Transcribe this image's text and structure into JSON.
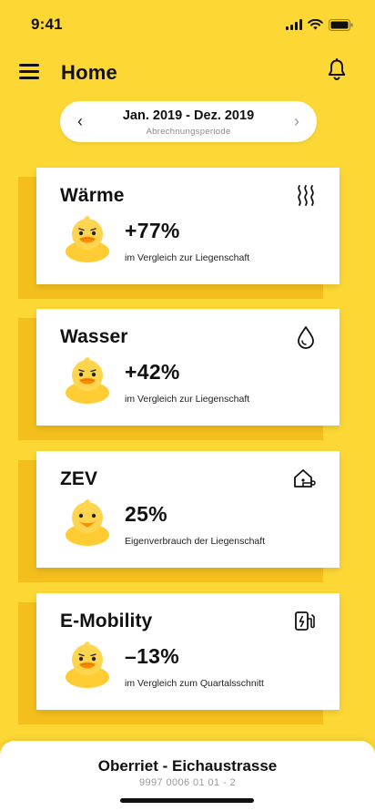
{
  "status_bar": {
    "time": "9:41"
  },
  "header": {
    "title": "Home",
    "menu_icon": "hamburger-menu-icon",
    "bell_icon": "bell-icon"
  },
  "period": {
    "range": "Jan. 2019 - Dez. 2019",
    "label": "Abrechnungsperiode",
    "prev_symbol": "‹",
    "next_symbol": "›"
  },
  "cards": [
    {
      "title": "Wärme",
      "icon": "heat-icon",
      "value": "+77%",
      "description": "im Vergleich zur Liegenschaft"
    },
    {
      "title": "Wasser",
      "icon": "water-drop-icon",
      "value": "+42%",
      "description": "im Vergleich zur Liegenschaft"
    },
    {
      "title": "ZEV",
      "icon": "smart-home-icon",
      "value": "25%",
      "description": "Eigenverbrauch der Liegenschaft"
    },
    {
      "title": "E-Mobility",
      "icon": "ev-charging-icon",
      "value": "–13%",
      "description": "im Vergleich zum Quartalsschnitt"
    }
  ],
  "location": {
    "name": "Oberriet - Eichaustrasse",
    "id": "9997 0006 01 01 - 2"
  },
  "colors": {
    "background": "#FDD835",
    "card_shadow_layer": "#F4BF1D",
    "duck_body": "#FFD54F",
    "duck_beak": "#FB8C00"
  }
}
